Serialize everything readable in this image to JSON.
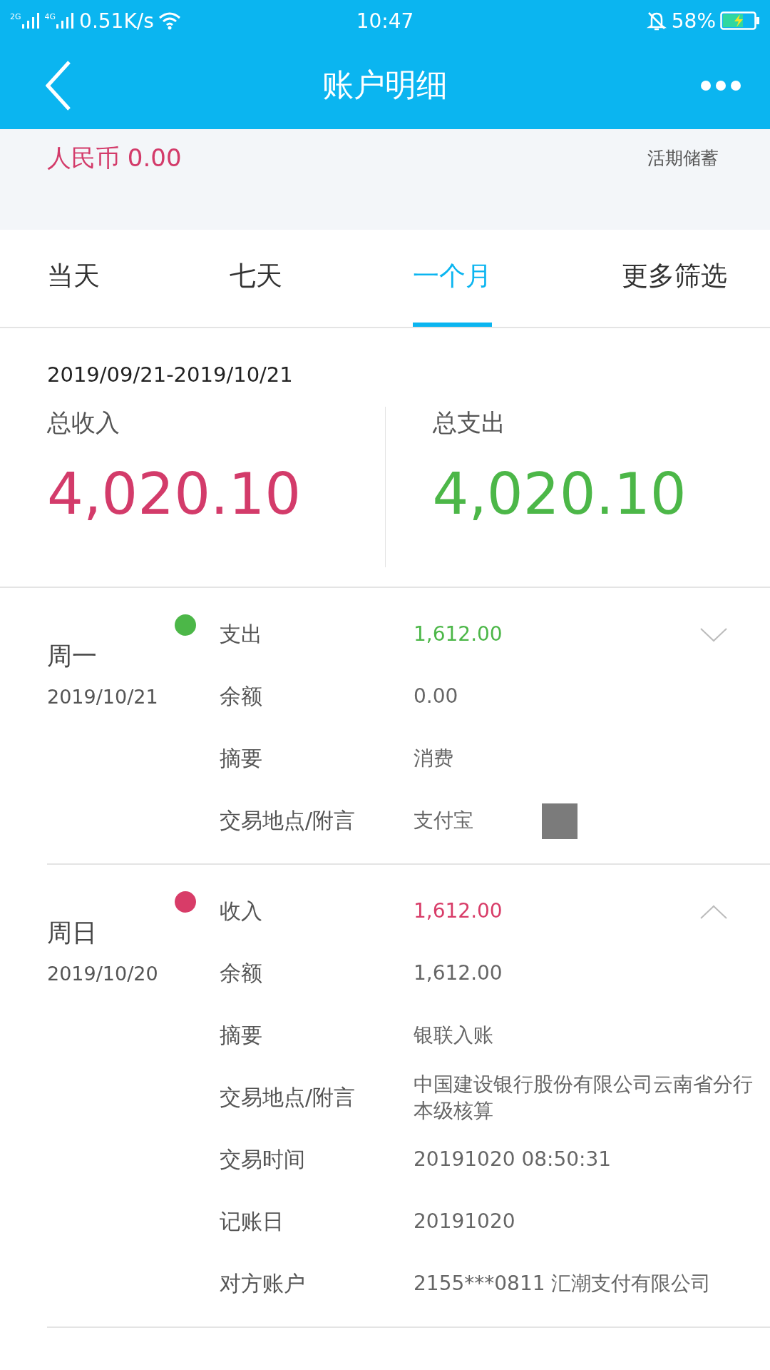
{
  "status_bar": {
    "networks": [
      "2G",
      "4G"
    ],
    "speed": "0.51K/s",
    "time": "10:47",
    "battery": "58%"
  },
  "header": {
    "title": "账户明细"
  },
  "account": {
    "currency_balance": "人民币 0.00",
    "type": "活期储蓄"
  },
  "tabs": [
    {
      "label": "当天",
      "selected": false
    },
    {
      "label": "七天",
      "selected": false
    },
    {
      "label": "一个月",
      "selected": true
    },
    {
      "label": "更多筛选",
      "selected": false
    }
  ],
  "summary": {
    "date_range": "2019/09/21-2019/10/21",
    "income_label": "总收入",
    "income": "4,020.10",
    "expense_label": "总支出",
    "expense": "4,020.10"
  },
  "transactions": [
    {
      "weekday": "周一",
      "date": "2019/10/21",
      "color": "#4cb748",
      "type": "支出",
      "amount": "1,612.00",
      "expanded": false,
      "details": [
        {
          "label": "余额",
          "value": "0.00",
          "redacted": false
        },
        {
          "label": "摘要",
          "value": "消费",
          "redacted": false
        },
        {
          "label": "交易地点/附言",
          "value": "支付宝",
          "redacted": true
        }
      ]
    },
    {
      "weekday": "周日",
      "date": "2019/10/20",
      "color": "#d83c68",
      "type": "收入",
      "amount": "1,612.00",
      "expanded": true,
      "details": [
        {
          "label": "余额",
          "value": "1,612.00",
          "redacted": false
        },
        {
          "label": "摘要",
          "value": "银联入账",
          "redacted": false
        },
        {
          "label": "交易地点/附言",
          "value": "中国建设银行股份有限公司云南省分行本级核算",
          "redacted": false
        },
        {
          "label": "交易时间",
          "value": "20191020 08:50:31",
          "redacted": false
        },
        {
          "label": "记账日",
          "value": "20191020",
          "redacted": false
        },
        {
          "label": "对方账户",
          "value": "2155***0811 汇潮支付有限公司",
          "redacted": false
        }
      ]
    }
  ]
}
